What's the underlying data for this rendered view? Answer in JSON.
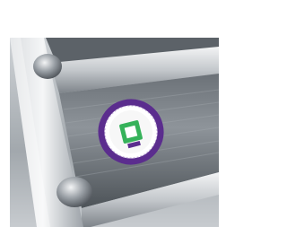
{
  "photo": {
    "subject": "metal-rail-with-round-sticker",
    "colors": {
      "metal_light": "#e6e8ea",
      "metal_mid": "#9aa0a6",
      "metal_dark": "#4a4f55",
      "sticker_purple": "#5b2d8e",
      "sticker_green": "#36b25a",
      "sticker_white": "#ffffff"
    }
  }
}
